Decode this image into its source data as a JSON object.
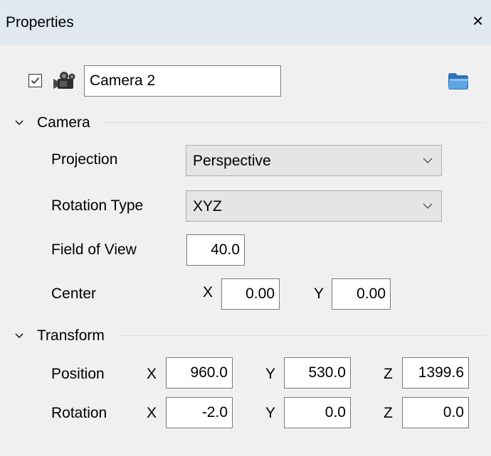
{
  "panel": {
    "title": "Properties",
    "close_glyph": "×"
  },
  "object": {
    "visible": true,
    "icon": "camera-icon",
    "name": "Camera 2",
    "browse_icon": "folder-icon"
  },
  "camera": {
    "section_label": "Camera",
    "projection": {
      "label": "Projection",
      "value": "Perspective"
    },
    "rotation_type": {
      "label": "Rotation Type",
      "value": "XYZ"
    },
    "field_of_view": {
      "label": "Field of View",
      "value": "40.0"
    },
    "center": {
      "label": "Center",
      "x_label": "X",
      "x": "0.00",
      "y_label": "Y",
      "y": "0.00"
    }
  },
  "transform": {
    "section_label": "Transform",
    "position": {
      "label": "Position",
      "x_label": "X",
      "x": "960.0",
      "y_label": "Y",
      "y": "530.0",
      "z_label": "Z",
      "z": "1399.6"
    },
    "rotation": {
      "label": "Rotation",
      "x_label": "X",
      "x": "-2.0",
      "y_label": "Y",
      "y": "0.0",
      "z_label": "Z",
      "z": "0.0"
    }
  },
  "colors": {
    "titlebar": "#e1e8f1",
    "background": "#f0f0f0",
    "folder": "#4a90d9"
  }
}
